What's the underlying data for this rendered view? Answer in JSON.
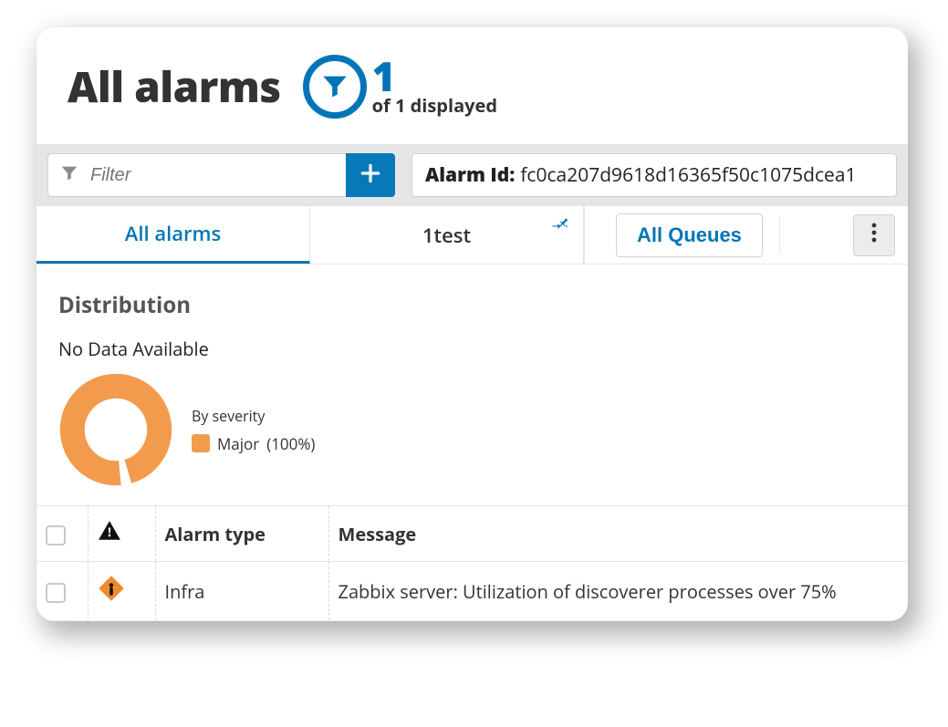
{
  "header": {
    "title": "All alarms",
    "count": "1",
    "count_sub": "of 1 displayed"
  },
  "filterbar": {
    "placeholder": "Filter",
    "chip_key": "Alarm Id",
    "chip_val": "fc0ca207d9618d16365f50c1075dcea1"
  },
  "tabs": [
    {
      "label": "All alarms",
      "active": true
    },
    {
      "label": "1test",
      "active": false,
      "pinned": true
    }
  ],
  "all_queues_label": "All Queues",
  "distribution": {
    "title": "Distribution",
    "status": "No Data Available",
    "legend_title": "By severity",
    "items": [
      {
        "label": "Major",
        "pct": "(100%)",
        "color": "#f39b4c"
      }
    ]
  },
  "table": {
    "headers": {
      "alarm_type": "Alarm type",
      "message": "Message"
    },
    "rows": [
      {
        "type": "Infra",
        "message": "Zabbix server: Utilization of discoverer processes over 75%",
        "severity": "major"
      }
    ]
  },
  "chart_data": {
    "type": "pie",
    "title": "By severity",
    "categories": [
      "Major"
    ],
    "values": [
      100
    ],
    "colors": [
      "#f39b4c"
    ]
  }
}
